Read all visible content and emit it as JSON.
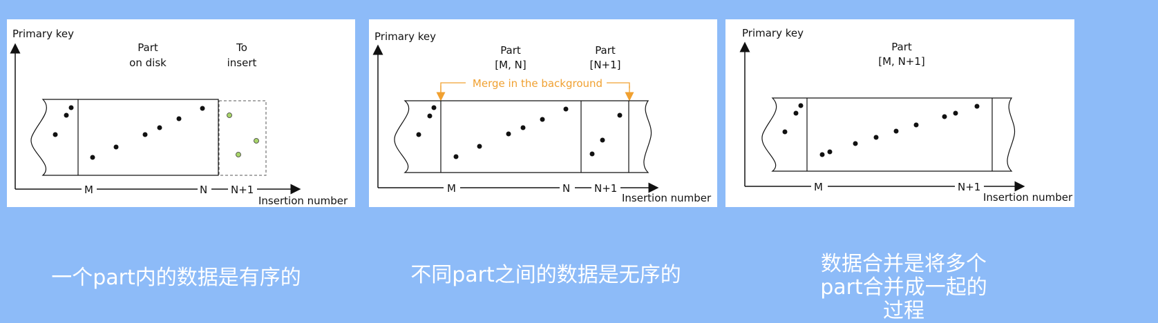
{
  "panels": [
    {
      "y_axis": "Primary key",
      "x_axis": "Insertion number",
      "top_labels": [
        [
          "Part",
          "on disk"
        ],
        [
          "To",
          "insert"
        ]
      ],
      "ticks": [
        "M",
        "N",
        "N+1"
      ]
    },
    {
      "y_axis": "Primary key",
      "x_axis": "Insertion number",
      "top_labels": [
        [
          "Part",
          "[M, N]"
        ],
        [
          "Part",
          "[N+1]"
        ]
      ],
      "merge_label": "Merge in the background",
      "ticks": [
        "M",
        "N",
        "N+1"
      ]
    },
    {
      "y_axis": "Primary key",
      "x_axis": "Insertion number",
      "top_labels": [
        [
          "Part",
          "[M, N+1]"
        ]
      ],
      "ticks": [
        "M",
        "N+1"
      ]
    }
  ],
  "captions": [
    "一个part内的数据是有序的",
    "不同part之间的数据是无序的",
    "数据合并是将多个part合并成一起的过程"
  ],
  "colors": {
    "background": "#8dbbf8",
    "merge_accent": "#f0a030",
    "new_point_fill": "#a8d46a"
  }
}
